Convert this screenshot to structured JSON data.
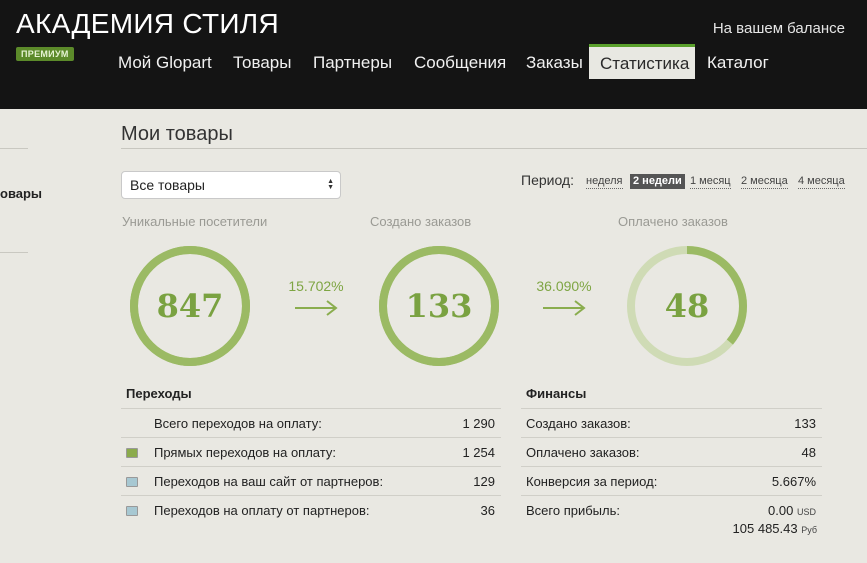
{
  "header": {
    "brand": "АКАДЕМИЯ СТИЛЯ",
    "badge": "ПРЕМИУМ",
    "balance_label": "На вашем балансе",
    "nav": [
      {
        "label": "Мой Glopart",
        "active": false
      },
      {
        "label": "Товары",
        "active": false
      },
      {
        "label": "Партнеры",
        "active": false
      },
      {
        "label": "Сообщения",
        "active": false
      },
      {
        "label": "Заказы",
        "active": false
      },
      {
        "label": "Статистика",
        "active": true
      },
      {
        "label": "Каталог",
        "active": false
      }
    ]
  },
  "sidebar": {
    "partial_item": "овары"
  },
  "main": {
    "title": "Мои товары",
    "product_select": {
      "value": "Все товары"
    },
    "period": {
      "label": "Период:",
      "options": [
        {
          "label": "неделя",
          "active": false
        },
        {
          "label": "2 недели",
          "active": true
        },
        {
          "label": "1 месяц",
          "active": false
        },
        {
          "label": "2 месяца",
          "active": false
        },
        {
          "label": "4 месяца",
          "active": false
        }
      ]
    },
    "funnel": {
      "visitors": {
        "label": "Уникальные посетители",
        "value": "847",
        "fill": 1.0
      },
      "rate1": "15.702%",
      "orders_created": {
        "label": "Создано заказов",
        "value": "133",
        "fill": 1.0
      },
      "rate2": "36.090%",
      "orders_paid": {
        "label": "Оплачено заказов",
        "value": "48",
        "fill": 0.3609
      }
    },
    "colors": {
      "ring": "#9bba64",
      "ring_track": "#cfdbb5",
      "accent": "#5aa02c"
    },
    "transitions": {
      "title": "Переходы",
      "rows": [
        {
          "label": "Всего переходов на оплату:",
          "value": "1 290",
          "swatch": ""
        },
        {
          "label": "Прямых переходов на оплату:",
          "value": "1 254",
          "swatch": "#8bab4c"
        },
        {
          "label": "Переходов на ваш сайт от партнеров:",
          "value": "129",
          "swatch": "#a7c8d2"
        },
        {
          "label": "Переходов на оплату от партнеров:",
          "value": "36",
          "swatch": "#a7c8d2"
        }
      ]
    },
    "finance": {
      "title": "Финансы",
      "rows": [
        {
          "label": "Создано заказов:",
          "value": "133",
          "unit": ""
        },
        {
          "label": "Оплачено заказов:",
          "value": "48",
          "unit": ""
        },
        {
          "label": "Конверсия за период:",
          "value": "5.667%",
          "unit": ""
        },
        {
          "label": "Всего прибыль:",
          "value": "0.00",
          "unit": "USD"
        }
      ],
      "profit_rub": {
        "value": "105 485.43",
        "unit": "Руб"
      }
    }
  }
}
